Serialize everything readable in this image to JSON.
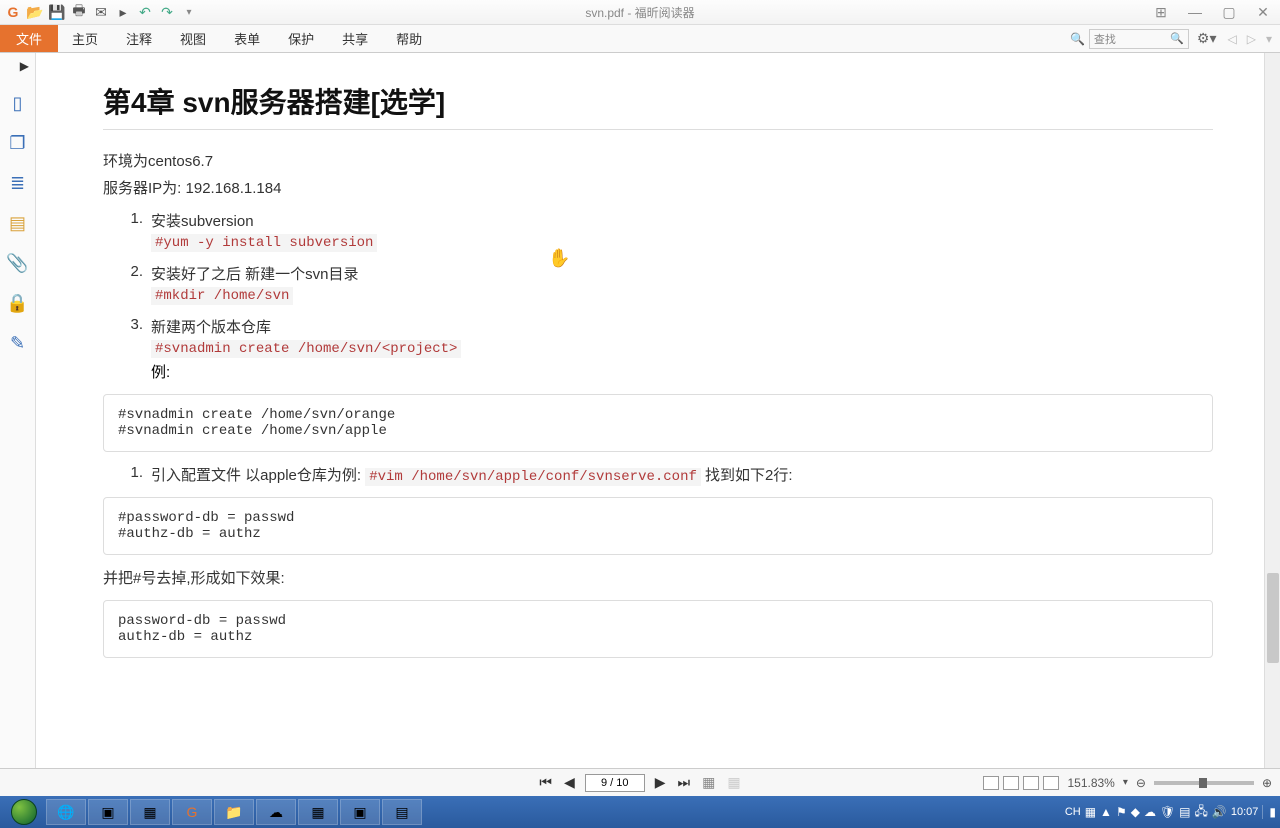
{
  "window": {
    "title": "svn.pdf - 福昕阅读器"
  },
  "menubar": {
    "file": "文件",
    "items": [
      "主页",
      "注释",
      "视图",
      "表单",
      "保护",
      "共享",
      "帮助"
    ],
    "search_placeholder": "查找"
  },
  "document": {
    "heading": "第4章 svn服务器搭建[选学]",
    "env_line": "环境为centos6.7",
    "ip_line": "服务器IP为: 192.168.1.184",
    "steps": [
      {
        "num": "1.",
        "text": "安装subversion",
        "code": "#yum -y install subversion"
      },
      {
        "num": "2.",
        "text": "安装好了之后 新建一个svn目录",
        "code": "#mkdir /home/svn"
      },
      {
        "num": "3.",
        "text": "新建两个版本仓库",
        "code": "#svnadmin create /home/svn/<project>"
      }
    ],
    "example_label": "例:",
    "example_block": "#svnadmin create /home/svn/orange\n#svnadmin create /home/svn/apple",
    "step4_num": "1.",
    "step4_prefix": "引入配置文件 以apple仓库为例: ",
    "step4_code": "#vim /home/svn/apple/conf/svnserve.conf",
    "step4_suffix": " 找到如下2行:",
    "conf_block1": "#password-db = passwd\n#authz-db = authz",
    "remove_hash": "并把#号去掉,形成如下效果:",
    "conf_block2": "password-db = passwd\nauthz-db = authz"
  },
  "statusbar": {
    "page": "9 / 10",
    "zoom": "151.83%"
  },
  "taskbar": {
    "lang": "CH",
    "time": "10:07"
  }
}
